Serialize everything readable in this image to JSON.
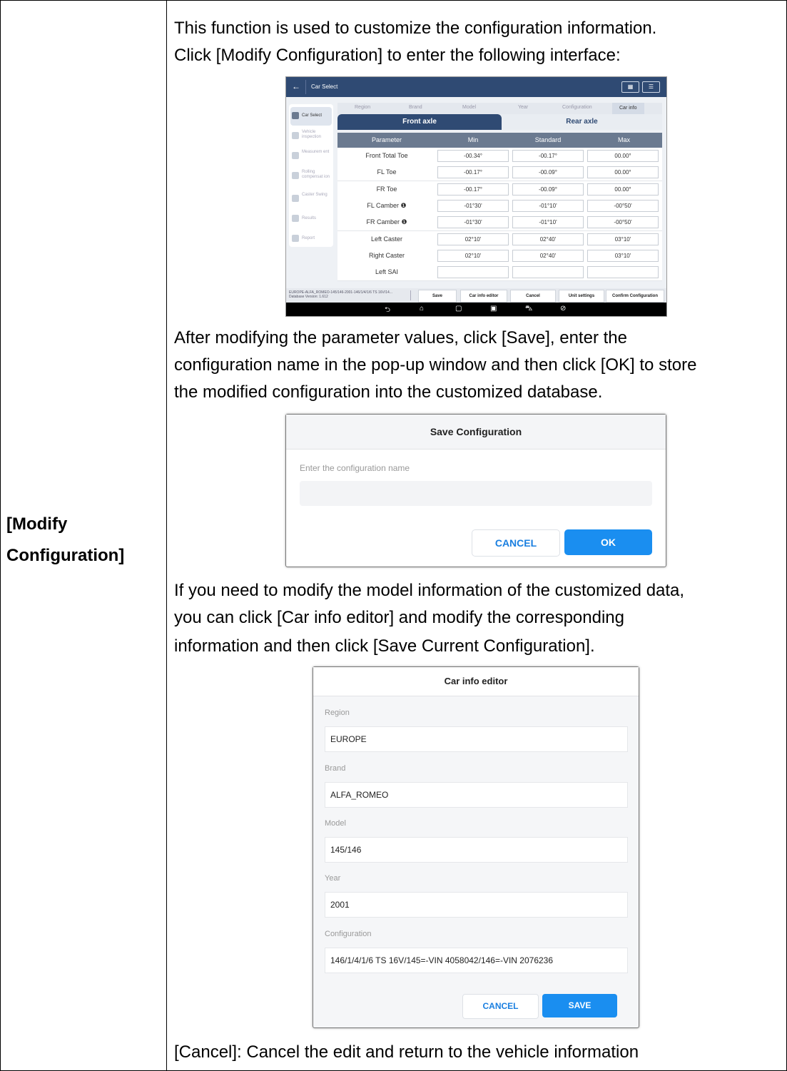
{
  "left_cell": {
    "label_line1": "[Modify",
    "label_line2": "Configuration]"
  },
  "paragraphs": {
    "intro_1": "This function is used to customize the configuration information.",
    "intro_2": "Click [Modify Configuration] to enter the following interface:",
    "after_1": "After modifying the parameter values, click [Save], enter the",
    "after_2": "configuration name in the pop-up window and then click [OK] to store",
    "after_3": "the modified configuration into the customized database.",
    "model_1": "If you need to modify the model information of the customized data,",
    "model_2": "you can click [Car info editor] and modify the corresponding",
    "model_3": "information and then click [Save Current Configuration].",
    "cancel_1": "[Cancel]: Cancel the edit and return to the vehicle information"
  },
  "screen1": {
    "title": "Car Select",
    "back_icon": "←",
    "sidebar": [
      "Car Select",
      "Vehicle inspection",
      "Measurem ent",
      "Rolling compensat ion",
      "Caster Swing",
      "Results",
      "Report"
    ],
    "breadcrumb": [
      "Region",
      "Brand",
      "Model",
      "Year",
      "Configuration",
      "Car info"
    ],
    "tabs": {
      "front": "Front axle",
      "rear": "Rear axle"
    },
    "headers": [
      "Parameter",
      "Min",
      "Standard",
      "Max"
    ],
    "rows": [
      {
        "name": "Front Total Toe",
        "min": "-00.34°",
        "std": "-00.17°",
        "max": "00.00°"
      },
      {
        "name": "FL Toe",
        "min": "-00.17°",
        "std": "-00.09°",
        "max": "00.00°"
      },
      {
        "name": "FR Toe",
        "min": "-00.17°",
        "std": "-00.09°",
        "max": "00.00°"
      },
      {
        "name": "FL Camber ❶",
        "min": "-01°30'",
        "std": "-01°10'",
        "max": "-00°50'"
      },
      {
        "name": "FR Camber ❶",
        "min": "-01°30'",
        "std": "-01°10'",
        "max": "-00°50'"
      },
      {
        "name": "Left Caster",
        "min": "02°10'",
        "std": "02°40'",
        "max": "03°10'"
      },
      {
        "name": "Right Caster",
        "min": "02°10'",
        "std": "02°40'",
        "max": "03°10'"
      },
      {
        "name": "Left SAI",
        "min": "",
        "std": "",
        "max": ""
      }
    ],
    "status_info_1": "EUROPE-ALFA_ROMEO-145/146-2001-146/1/4/1/6 TS 16V/14...",
    "status_info_2": "Database Version: 1.612",
    "buttons": {
      "save": "Save",
      "editor": "Car info editor",
      "cancel": "Cancel",
      "units": "Unit settings",
      "confirm": "Confirm Configuration"
    }
  },
  "save_dialog": {
    "title": "Save Configuration",
    "label": "Enter the configuration name",
    "cancel": "CANCEL",
    "ok": "OK"
  },
  "editor_dialog": {
    "title": "Car info editor",
    "fields": [
      {
        "label": "Region",
        "value": "EUROPE"
      },
      {
        "label": "Brand",
        "value": "ALFA_ROMEO"
      },
      {
        "label": "Model",
        "value": "145/146"
      },
      {
        "label": "Year",
        "value": "2001"
      },
      {
        "label": "Configuration",
        "value": "146/1/4/1/6 TS 16V/145=-VIN 4058042/146=-VIN 2076236"
      }
    ],
    "cancel": "CANCEL",
    "save": "SAVE"
  }
}
